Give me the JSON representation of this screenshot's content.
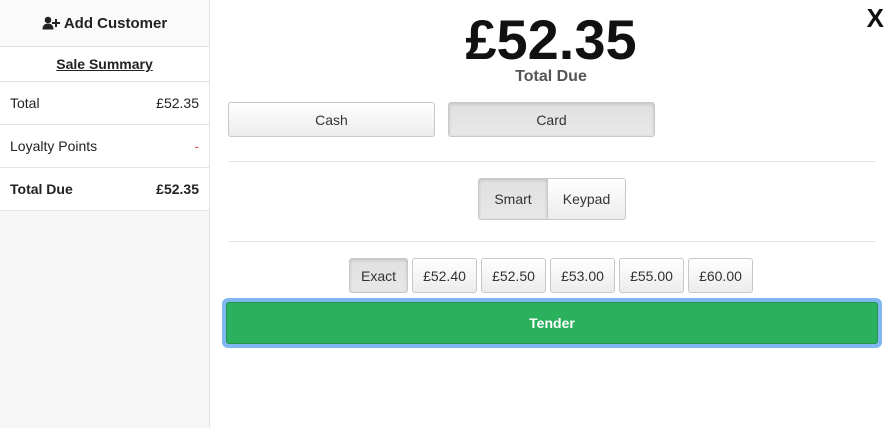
{
  "sidebar": {
    "add_customer_label": "Add Customer",
    "summary_title": "Sale Summary",
    "rows": [
      {
        "label": "Total",
        "value": "£52.35"
      },
      {
        "label": "Loyalty Points",
        "value": "-"
      },
      {
        "label": "Total Due",
        "value": "£52.35"
      }
    ]
  },
  "main": {
    "close_label": "X",
    "amount": "£52.35",
    "amount_label": "Total Due",
    "payment_methods": [
      "Cash",
      "Card"
    ],
    "selected_payment_method": "Card",
    "input_modes": [
      "Smart",
      "Keypad"
    ],
    "selected_input_mode": "Smart",
    "quick_amounts": [
      "Exact",
      "£52.40",
      "£52.50",
      "£53.00",
      "£55.00",
      "£60.00"
    ],
    "selected_quick_amount": "Exact",
    "tender_label": "Tender"
  },
  "colors": {
    "tender": "#2bb05e",
    "focus_ring": "#7fb8f0",
    "loyalty_dash": "#d9534f"
  }
}
